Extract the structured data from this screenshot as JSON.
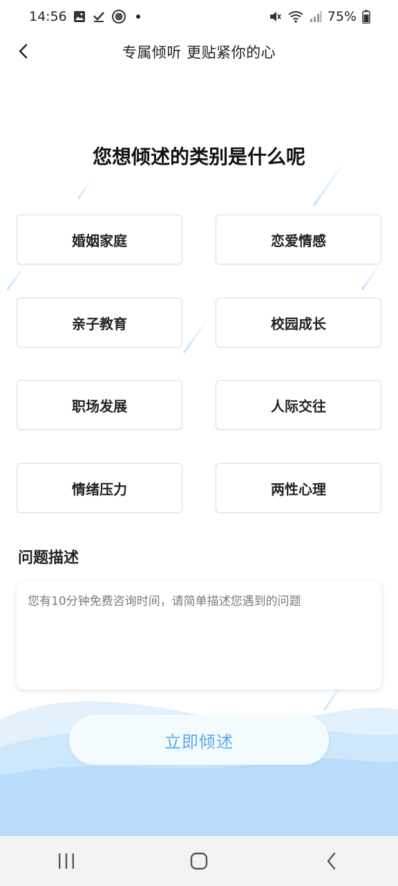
{
  "status_bar": {
    "time": "14:56",
    "battery": "75%",
    "left_icons": [
      "gallery-icon",
      "check-icon",
      "circle-app-icon",
      "notification-dot"
    ],
    "right_icons": [
      "mute-icon",
      "wifi-icon",
      "signal-icon",
      "battery-icon"
    ]
  },
  "header": {
    "title": "专属倾听 更贴紧你的心"
  },
  "main": {
    "heading": "您想倾述的类别是什么呢",
    "categories": [
      {
        "label": "婚姻家庭"
      },
      {
        "label": "恋爱情感"
      },
      {
        "label": "亲子教育"
      },
      {
        "label": "校园成长"
      },
      {
        "label": "职场发展"
      },
      {
        "label": "人际交往"
      },
      {
        "label": "情绪压力"
      },
      {
        "label": "两性心理"
      }
    ],
    "description": {
      "label": "问题描述",
      "placeholder": "您有10分钟免费咨询时间，请简单描述您遇到的问题",
      "value": ""
    },
    "submit_label": "立即倾述"
  },
  "colors": {
    "accent": "#5aa8e6",
    "wave_light": "#d7ecfb",
    "wave_dark": "#b5dbfa"
  }
}
